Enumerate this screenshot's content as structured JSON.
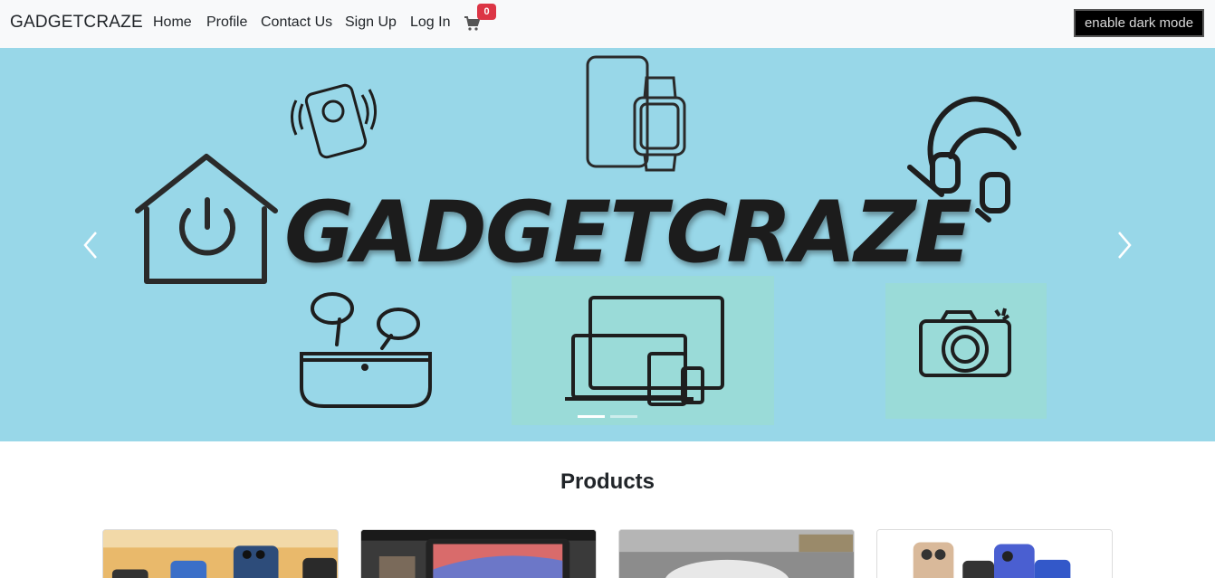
{
  "navbar": {
    "brand": "GADGETCRAZE",
    "links": [
      "Home",
      "Profile",
      "Contact Us",
      "Sign Up",
      "Log In"
    ],
    "cart_icon": "cart-icon",
    "cart_count": "0",
    "dark_mode_label": "enable dark mode"
  },
  "carousel": {
    "banner_text": "GADGETCRAZE",
    "slides": 2,
    "active_slide": 1,
    "prev_icon": "chevron-left-icon",
    "next_icon": "chevron-right-icon",
    "background_color": "#98d7e8"
  },
  "products": {
    "heading": "Products"
  },
  "colors": {
    "badge": "#dc3545",
    "navbar_bg": "#f8f9fa"
  }
}
